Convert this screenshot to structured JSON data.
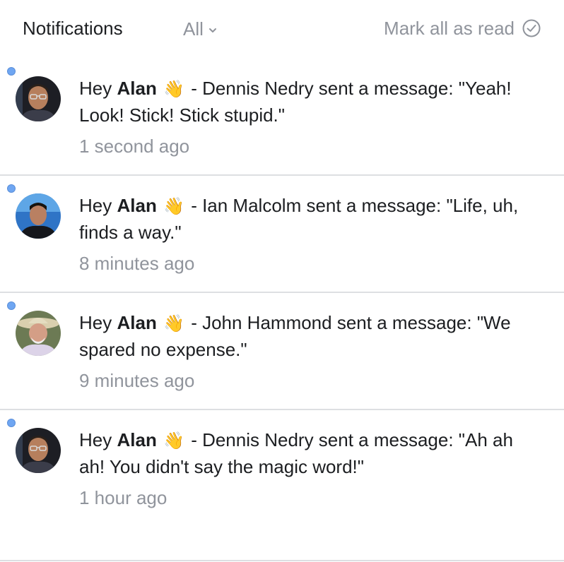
{
  "header": {
    "title": "Notifications",
    "filter_label": "All",
    "mark_all_label": "Mark all as read"
  },
  "colors": {
    "unread_dot": "#6fa6f2",
    "muted_text": "#90949c",
    "divider": "#dddfe2"
  },
  "notifications": [
    {
      "greeting": "Hey",
      "name": "Alan",
      "emoji": "👋",
      "text": "- Dennis Nedry sent a message: \"Yeah! Look! Stick! Stick stupid.\"",
      "time": "1 second ago",
      "avatar": "dennis-nedry-avatar",
      "unread": true
    },
    {
      "greeting": "Hey",
      "name": "Alan",
      "emoji": "👋",
      "text": "- Ian Malcolm sent a message: \"Life, uh, finds a way.\"",
      "time": "8 minutes ago",
      "avatar": "ian-malcolm-avatar",
      "unread": true
    },
    {
      "greeting": "Hey",
      "name": "Alan",
      "emoji": "👋",
      "text": "- John Hammond sent a message: \"We spared no expense.\"",
      "time": "9 minutes ago",
      "avatar": "john-hammond-avatar",
      "unread": true
    },
    {
      "greeting": "Hey",
      "name": "Alan",
      "emoji": "👋",
      "text": "- Dennis Nedry sent a message: \"Ah ah ah! You didn't say the magic word!\"",
      "time": "1 hour ago",
      "avatar": "dennis-nedry-avatar",
      "unread": true
    }
  ]
}
